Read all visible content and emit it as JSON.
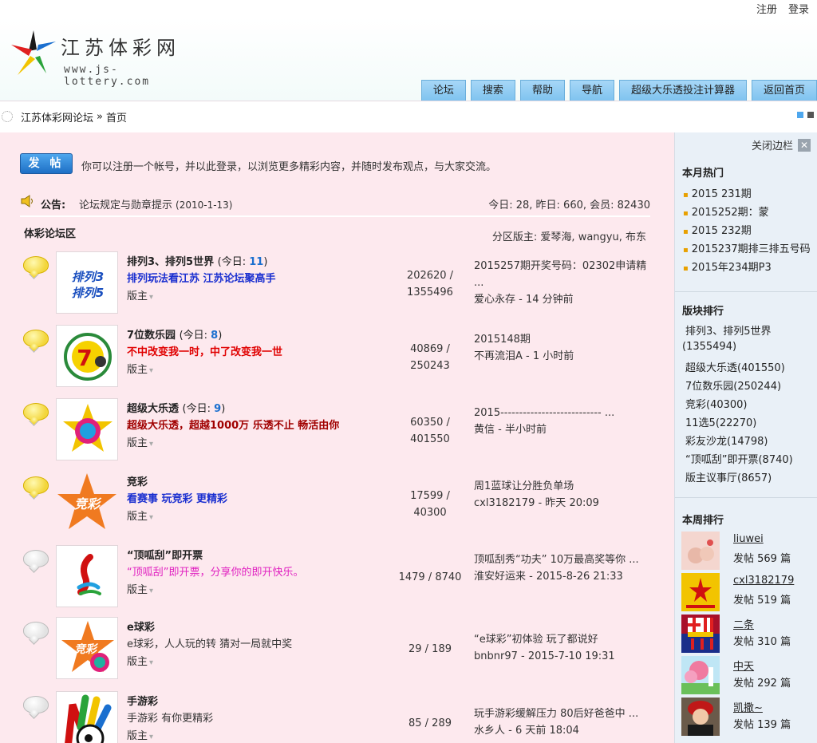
{
  "top": {
    "register": "注册",
    "login": "登录"
  },
  "logo": {
    "title": "江苏体彩网",
    "url": "www.js-lottery.com"
  },
  "nav": [
    "论坛",
    "搜索",
    "帮助",
    "导航",
    "超级大乐透投注计算器",
    "返回首页"
  ],
  "breadcrumb": {
    "forum": "江苏体彩网论坛",
    "sep": "»",
    "current": "首页"
  },
  "main": {
    "post_button": "发 帖",
    "welcome": "你可以注册一个帐号，并以此登录，以浏览更多精彩内容，并随时发布观点，与大家交流。",
    "announce_label": "公告:",
    "announce_text": "论坛规定与勋章提示",
    "announce_date": "(2010-1-13)",
    "stats": "今日: 28, 昨日: 660, 会员: 82430",
    "section_title": "体彩论坛区",
    "moderators": "分区版主: 爱琴海, wangyu, 布东",
    "forums": [
      {
        "name": "排列3、排列5世界",
        "today_label": "(今日: ",
        "today": "11",
        "today_end": ")",
        "desc": "排列玩法看江苏 江苏论坛聚高手",
        "desc_color": "#1a2fd0",
        "mod": "版主",
        "topics": "202620 /",
        "posts": "1355496",
        "last_title": "2015257期开奖号码：02302申请精 ...",
        "last_meta": "爱心永存 - 14 分钟前",
        "bulb": "on"
      },
      {
        "name": "7位数乐园",
        "today_label": "(今日: ",
        "today": "8",
        "today_end": ")",
        "desc": "不中改变我一时，中了改变我一世",
        "desc_color": "#e00000",
        "mod": "版主",
        "topics": "40869 /",
        "posts": "250243",
        "last_title": "2015148期",
        "last_meta": "不再流泪A - 1 小时前",
        "bulb": "on"
      },
      {
        "name": "超级大乐透",
        "today_label": "(今日: ",
        "today": "9",
        "today_end": ")",
        "desc": "超级大乐透，超越1000万 乐透不止 畅活由你",
        "desc_color": "#a00000",
        "mod": "版主",
        "topics": "60350 /",
        "posts": "401550",
        "last_title": "2015--------------------------- ...",
        "last_meta": "黄信 - 半小时前",
        "bulb": "on"
      },
      {
        "name": "竞彩",
        "today_label": "",
        "today": "",
        "today_end": "",
        "desc": "看赛事 玩竞彩 更精彩",
        "desc_color": "#1a2fd0",
        "mod": "版主",
        "topics": "17599 /",
        "posts": "40300",
        "last_title": "周1蓝球让分胜负单场",
        "last_meta": "cxl3182179 - 昨天 20:09",
        "bulb": "on"
      },
      {
        "name": "“顶呱刮”即开票",
        "today_label": "",
        "today": "",
        "today_end": "",
        "desc": "“顶呱刮”即开票，分享你的即开快乐。",
        "desc_color": "#e020c0",
        "mod": "版主",
        "topics": "1479 / 8740",
        "posts": "",
        "last_title": "顶呱刮秀“功夫” 10万最高奖等你 ...",
        "last_meta": "淮安好运来 - 2015-8-26 21:33",
        "bulb": "off"
      },
      {
        "name": "e球彩",
        "today_label": "",
        "today": "",
        "today_end": "",
        "desc": "e球彩，人人玩的转 猜对一局就中奖",
        "desc_color": "#333333",
        "mod": "版主",
        "topics": "29 / 189",
        "posts": "",
        "last_title": "“e球彩”初体验 玩了都说好",
        "last_meta": "bnbnr97 - 2015-7-10 19:31",
        "bulb": "off"
      },
      {
        "name": "手游彩",
        "today_label": "",
        "today": "",
        "today_end": "",
        "desc": "手游彩 有你更精彩",
        "desc_color": "#333333",
        "mod": "版主",
        "topics": "85 / 289",
        "posts": "",
        "last_title": "玩手游彩缓解压力 80后好爸爸中 ...",
        "last_meta": "水乡人 - 6 天前 18:04",
        "bulb": "off"
      }
    ]
  },
  "sidebar": {
    "close": "关闭边栏",
    "hot_title": "本月热门",
    "hot": [
      "2015 231期",
      "2015252期：蒙",
      "2015 232期",
      "2015237期排三排五号码",
      "2015年234期P3"
    ],
    "rank_title": "版块排行",
    "rank": [
      "排列3、排列5世界",
      "(1355494)",
      "超级大乐透(401550)",
      "7位数乐园(250244)",
      "竞彩(40300)",
      "11选5(22270)",
      "彩友沙龙(14798)",
      "“顶呱刮”即开票(8740)",
      "版主议事厅(8657)"
    ],
    "week_title": "本周排行",
    "week": [
      {
        "name": "liuwei",
        "posts": "发帖 569 篇"
      },
      {
        "name": "cxl3182179",
        "posts": "发帖 519 篇"
      },
      {
        "name": "二条",
        "posts": "发帖 310 篇"
      },
      {
        "name": "中天",
        "posts": "发帖 292 篇"
      },
      {
        "name": "凯撒~",
        "posts": "发帖 139 篇"
      }
    ]
  }
}
